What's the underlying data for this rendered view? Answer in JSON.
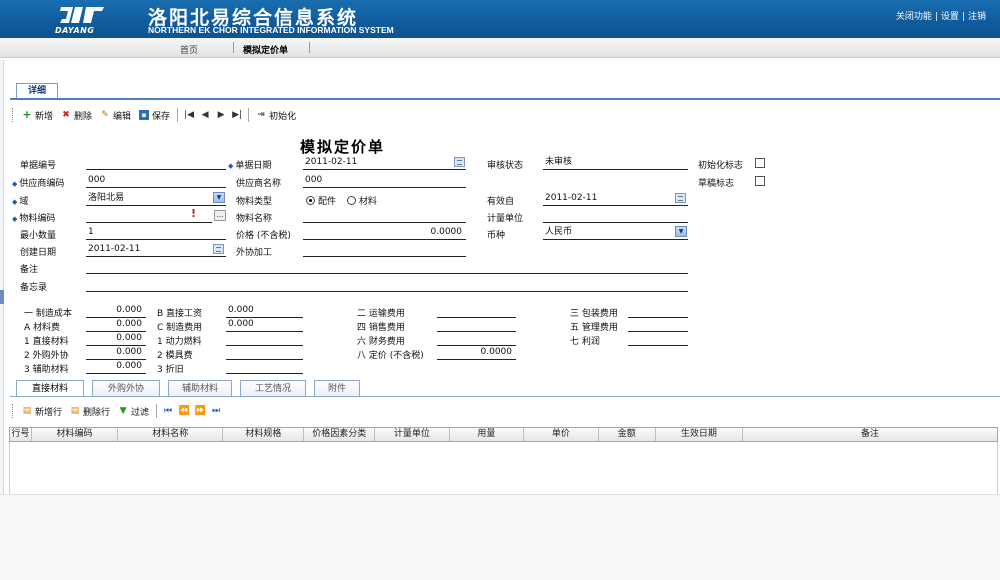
{
  "header": {
    "logo_text": "DAYANG",
    "system_title": "洛阳北易综合信息系统",
    "system_subtitle": "NORTHERN EK CHOR INTEGRATED INFORMATION SYSTEM",
    "links": [
      "关闭功能",
      "设置",
      "注销"
    ]
  },
  "nav": {
    "tabs": [
      "首页",
      "模拟定价单"
    ]
  },
  "detail_tab": "详细",
  "toolbar": {
    "add": "新增",
    "delete": "删除",
    "edit": "编辑",
    "save": "保存",
    "init": "初始化"
  },
  "form": {
    "title": "模拟定价单",
    "labels": {
      "doc_no": "单据编号",
      "supplier_code": "供应商编码",
      "domain": "域",
      "material_code": "物料编码",
      "min_qty": "最小数量",
      "created_date": "创建日期",
      "remarks": "备注",
      "memo": "备忘录",
      "doc_date": "单据日期",
      "supplier_name": "供应商名称",
      "material_type": "物料类型",
      "material_name": "物料名称",
      "price_ex_tax": "价格 (不含税)",
      "outsourcing": "外协加工",
      "review_status": "审核状态",
      "effective_from": "有效自",
      "unit": "计量单位",
      "currency": "币种",
      "init_flag": "初始化标志",
      "draft_flag": "草稿标志"
    },
    "values": {
      "doc_no": "",
      "supplier_code": "000",
      "domain": "洛阳北易",
      "material_code": "",
      "min_qty": "1",
      "created_date": "2011-02-11",
      "remarks": "",
      "memo": "",
      "doc_date": "2011-02-11",
      "supplier_name": "000",
      "material_name": "",
      "price_ex_tax": "0.0000",
      "outsourcing": "",
      "review_status": "未审核",
      "effective_from": "2011-02-11",
      "unit": "",
      "currency": "人民币"
    },
    "material_type_options": [
      "配件",
      "材料"
    ],
    "material_type_selected": "配件",
    "init_flag": false,
    "draft_flag": false
  },
  "costs": {
    "col1": [
      {
        "label": "一 制造成本",
        "value": "0.000"
      },
      {
        "label": "A 材料费",
        "value": "0.000"
      },
      {
        "label": "1 直接材料",
        "value": "0.000"
      },
      {
        "label": "2 外购外协",
        "value": "0.000"
      },
      {
        "label": "3 辅助材料",
        "value": "0.000"
      }
    ],
    "col2": [
      {
        "label": "B 直接工资",
        "value": "0.000"
      },
      {
        "label": "C 制造费用",
        "value": "0.000"
      },
      {
        "label": "1 动力燃料",
        "value": ""
      },
      {
        "label": "2 模具费",
        "value": ""
      },
      {
        "label": "3 折旧",
        "value": ""
      }
    ],
    "col3": [
      {
        "label": "二 运输费用",
        "value": ""
      },
      {
        "label": "四 销售费用",
        "value": ""
      },
      {
        "label": "六 财务费用",
        "value": ""
      },
      {
        "label": "八 定价 (不含税)",
        "value": "0.0000"
      }
    ],
    "col4": [
      {
        "label": "三 包装费用",
        "value": ""
      },
      {
        "label": "五 管理费用",
        "value": ""
      },
      {
        "label": "七 利润",
        "value": ""
      }
    ]
  },
  "subtabs": [
    "直接材料",
    "外购外协",
    "辅助材料",
    "工艺情况",
    "附件"
  ],
  "grid_toolbar": {
    "add_row": "新增行",
    "delete_row": "删除行",
    "filter": "过滤"
  },
  "grid": {
    "columns": [
      "行号",
      "材料编码",
      "材料名称",
      "材料规格",
      "价格因素分类",
      "计量单位",
      "用量",
      "单价",
      "金额",
      "生效日期",
      "备注"
    ]
  }
}
